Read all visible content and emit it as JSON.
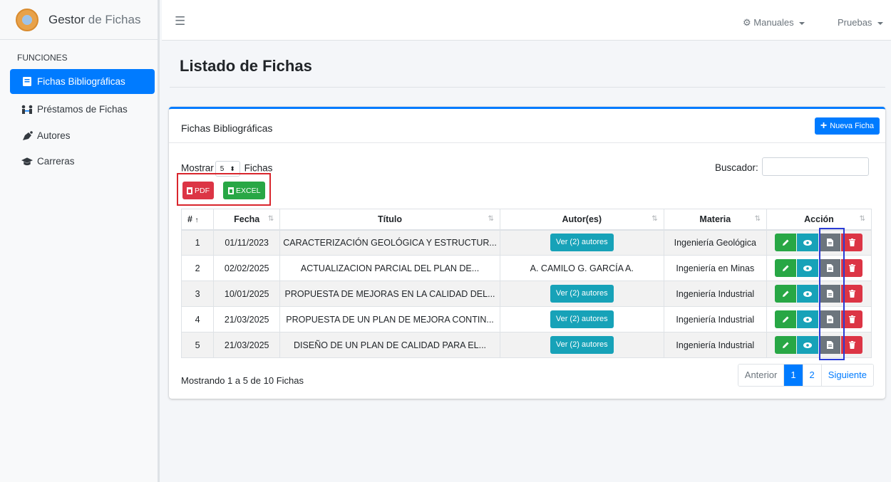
{
  "brand": {
    "name_strong": "Gestor",
    "name_light": " de Fichas"
  },
  "sidebar": {
    "header": "FUNCIONES",
    "items": [
      {
        "label": "Fichas Bibliográficas",
        "icon": "book-icon",
        "active": true
      },
      {
        "label": "Préstamos de Fichas",
        "icon": "people-exchange-icon",
        "active": false
      },
      {
        "label": "Autores",
        "icon": "pen-nib-icon",
        "active": false
      },
      {
        "label": "Carreras",
        "icon": "graduation-cap-icon",
        "active": false
      }
    ]
  },
  "topbar": {
    "manuals": "Manuales",
    "user": "Pruebas"
  },
  "page": {
    "title": "Listado de Fichas"
  },
  "card": {
    "title": "Fichas Bibliográficas",
    "new_button": "Nueva Ficha",
    "show_prefix": "Mostrar",
    "show_value": "5",
    "show_suffix": "Fichas",
    "search_label": "Buscador:",
    "search_value": "",
    "pdf_label": "PDF",
    "excel_label": "EXCEL"
  },
  "table": {
    "columns": [
      "#",
      "Fecha",
      "Título",
      "Autor(es)",
      "Materia",
      "Acción"
    ],
    "rows": [
      {
        "n": "1",
        "fecha": "01/11/2023",
        "titulo": "CARACTERIZACIÓN GEOLÓGICA Y ESTRUCTUR...",
        "autor": "Ver (2) autores",
        "autor_is_button": true,
        "materia": "Ingeniería Geológica"
      },
      {
        "n": "2",
        "fecha": "02/02/2025",
        "titulo": "ACTUALIZACION PARCIAL DEL PLAN DE...",
        "autor": "A. CAMILO G. GARCÍA A.",
        "autor_is_button": false,
        "materia": "Ingeniería en Minas"
      },
      {
        "n": "3",
        "fecha": "10/01/2025",
        "titulo": "PROPUESTA DE MEJORAS EN LA CALIDAD DEL...",
        "autor": "Ver (2) autores",
        "autor_is_button": true,
        "materia": "Ingeniería Industrial"
      },
      {
        "n": "4",
        "fecha": "21/03/2025",
        "titulo": "PROPUESTA DE UN PLAN DE MEJORA CONTIN...",
        "autor": "Ver (2) autores",
        "autor_is_button": true,
        "materia": "Ingeniería Industrial"
      },
      {
        "n": "5",
        "fecha": "21/03/2025",
        "titulo": "DISEÑO DE UN PLAN DE CALIDAD PARA EL...",
        "autor": "Ver (2) autores",
        "autor_is_button": true,
        "materia": "Ingeniería Industrial"
      }
    ]
  },
  "footer": {
    "info": "Mostrando 1 a 5 de 10 Fichas",
    "prev": "Anterior",
    "pages": [
      "1",
      "2"
    ],
    "current_page": "1",
    "next": "Siguiente"
  },
  "colors": {
    "primary": "#007bff",
    "success": "#28a745",
    "info": "#17a2b8",
    "danger": "#dc3545",
    "secondary": "#6c757d",
    "highlight_red": "#d9262d",
    "highlight_blue": "#2a3bd6"
  }
}
